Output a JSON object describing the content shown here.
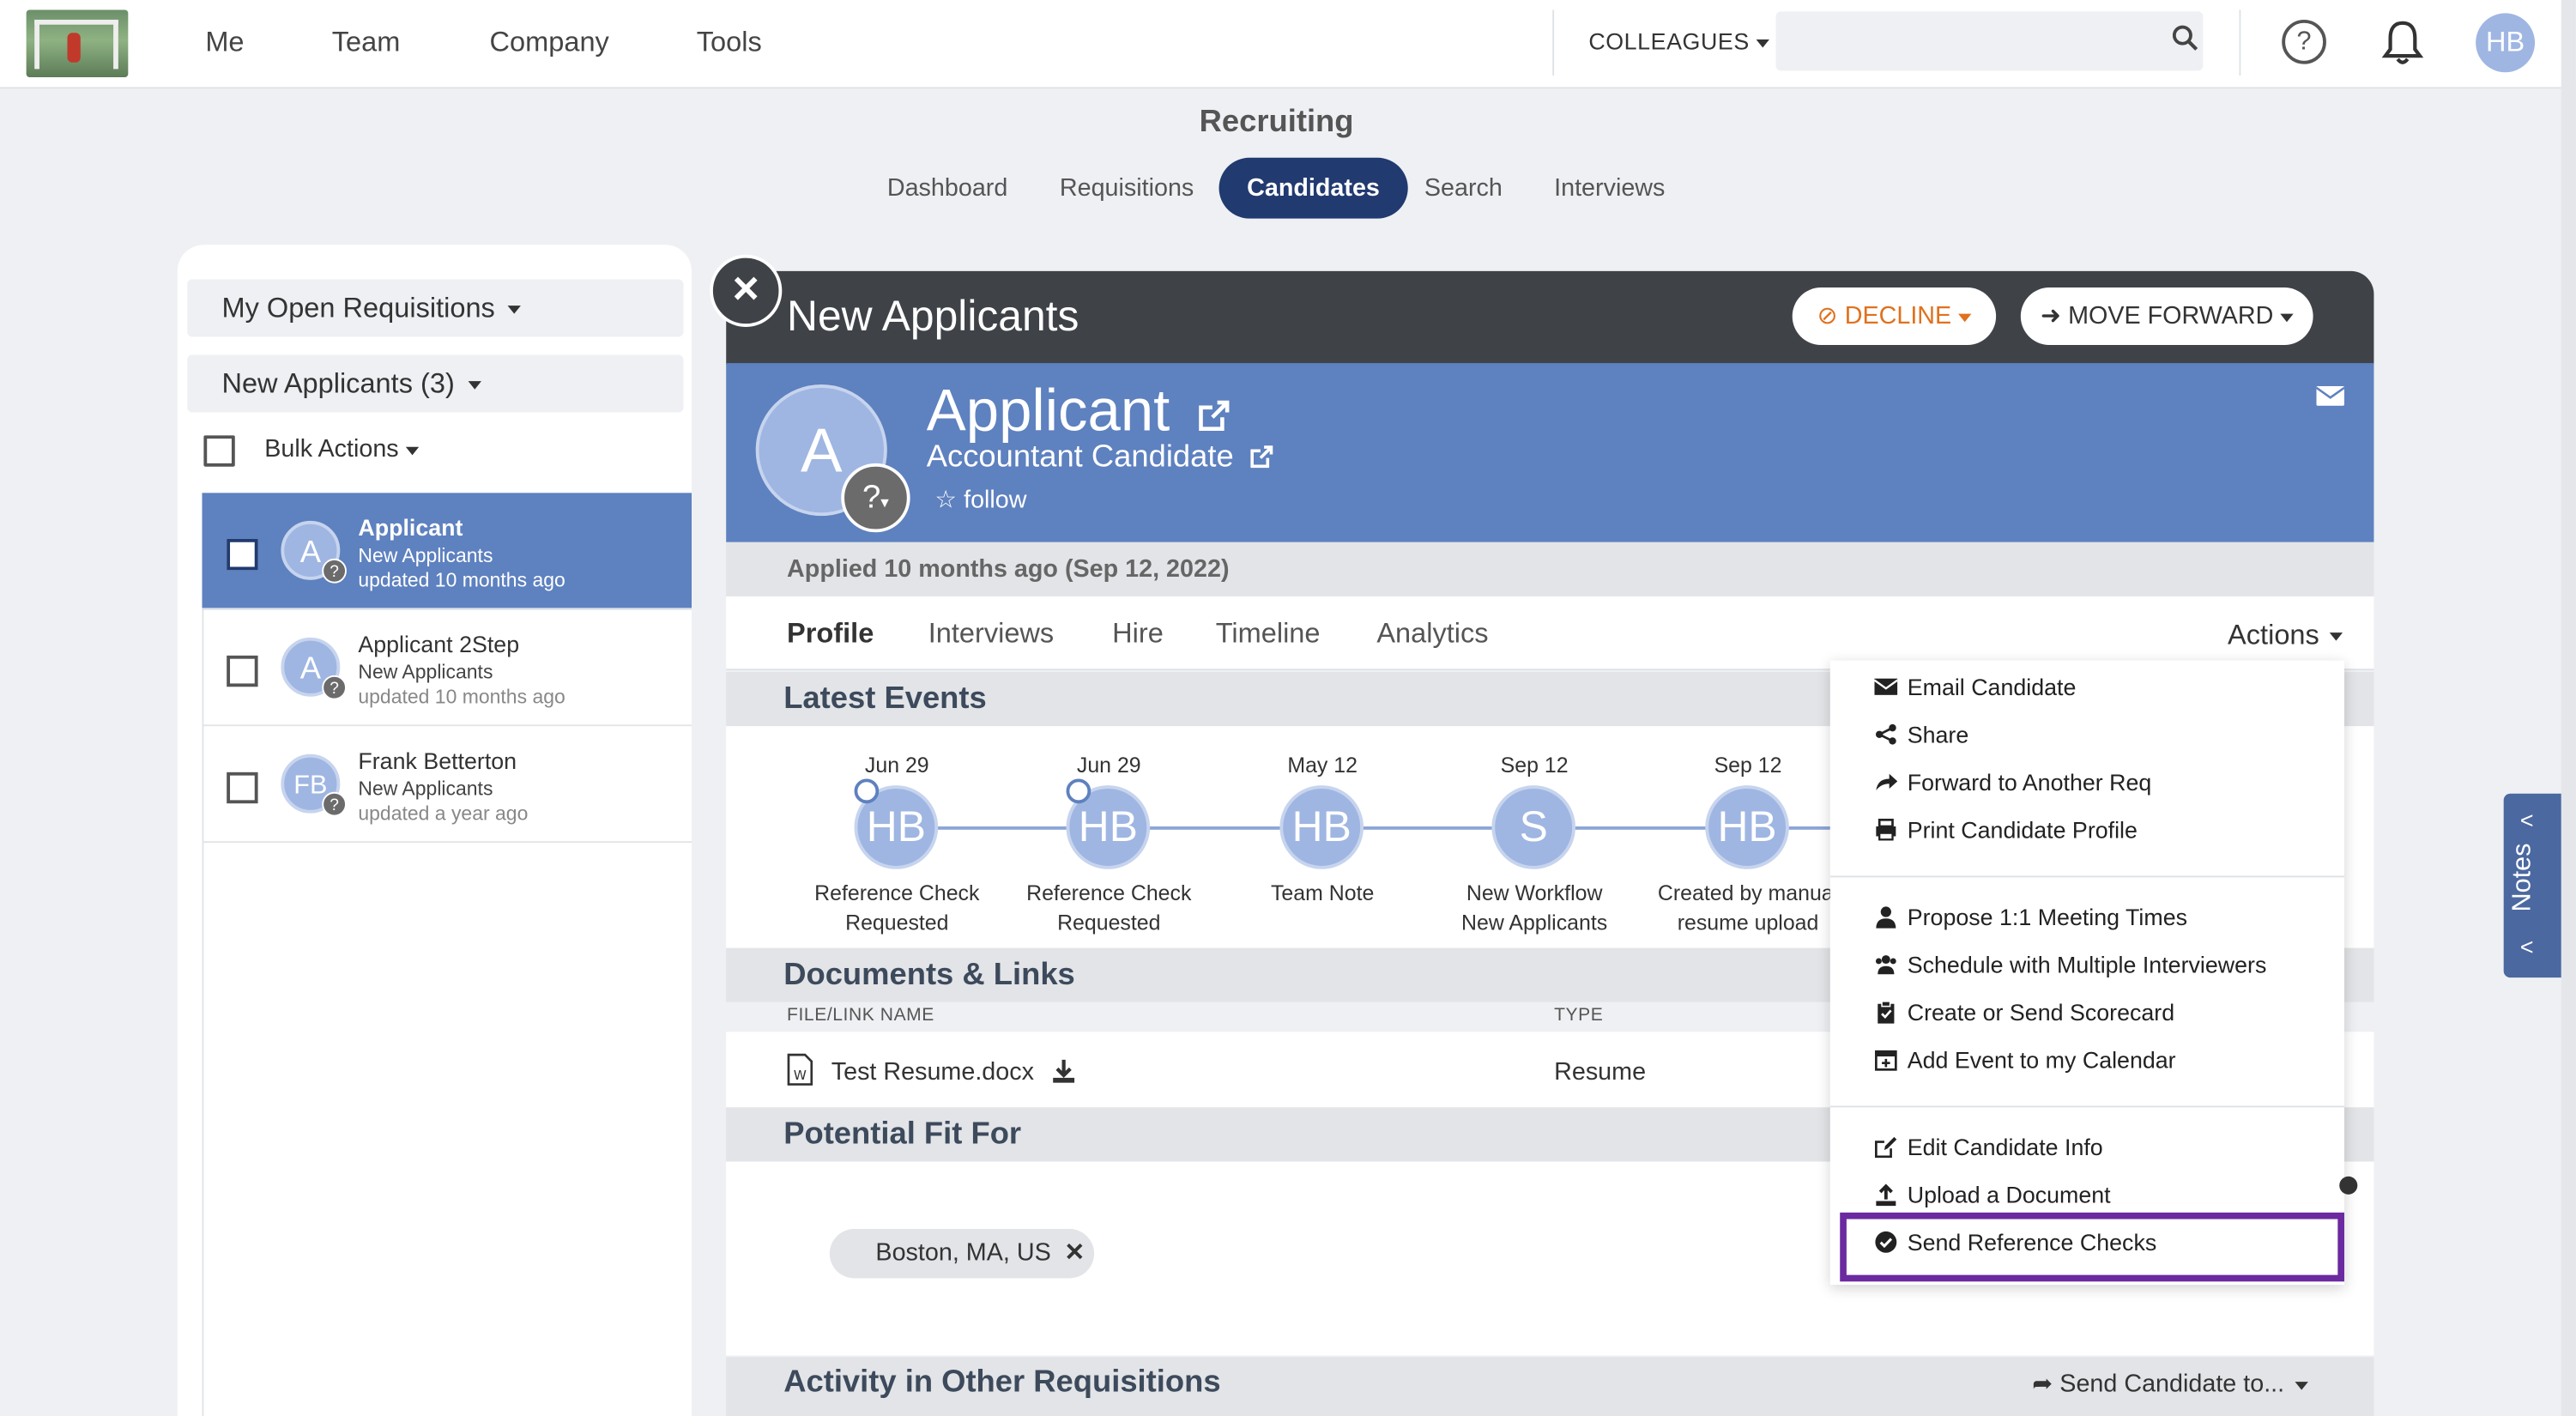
{
  "topnav": {
    "items": [
      "Me",
      "Team",
      "Company",
      "Tools"
    ],
    "colleagues_label": "COLLEAGUES",
    "search_value": "",
    "help_glyph": "?",
    "user_initials": "HB"
  },
  "recruiting": {
    "title": "Recruiting",
    "tabs": [
      "Dashboard",
      "Requisitions",
      "Candidates",
      "Search",
      "Interviews"
    ],
    "active_tab": "Candidates"
  },
  "left_panel": {
    "requisition_filter": "My Open Requisitions",
    "stage_filter": "New Applicants (3)",
    "bulk_actions": "Bulk Actions",
    "candidates": [
      {
        "initials": "A",
        "name": "Applicant",
        "stage": "New Applicants",
        "updated": "updated 10 months ago",
        "active": true
      },
      {
        "initials": "A",
        "name": "Applicant 2Step",
        "stage": "New Applicants",
        "updated": "updated 10 months ago",
        "active": false
      },
      {
        "initials": "FB",
        "name": "Frank Betterton",
        "stage": "New Applicants",
        "updated": "updated a year ago",
        "active": false
      }
    ]
  },
  "detail": {
    "stage_title": "New Applicants",
    "decline_label": "DECLINE",
    "move_forward_label": "MOVE FORWARD",
    "avatar_initial": "A",
    "candidate_name": "Applicant",
    "candidate_role": "Accountant Candidate",
    "follow_label": "follow",
    "applied": "Applied 10 months ago (Sep 12, 2022)",
    "tabs": [
      "Profile",
      "Interviews",
      "Hire",
      "Timeline",
      "Analytics"
    ],
    "actions_label": "Actions",
    "latest_events_title": "Latest Events",
    "events": [
      {
        "date": "Jun 29",
        "initials": "HB",
        "label1": "Reference Check",
        "label2": "Requested"
      },
      {
        "date": "Jun 29",
        "initials": "HB",
        "label1": "Reference Check",
        "label2": "Requested"
      },
      {
        "date": "May 12",
        "initials": "HB",
        "label1": "Team Note",
        "label2": ""
      },
      {
        "date": "Sep 12",
        "initials": "S",
        "label1": "New Workflow",
        "label2": "New Applicants"
      },
      {
        "date": "Sep 12",
        "initials": "HB",
        "label1": "Created by manual",
        "label2": "resume upload"
      }
    ],
    "documents_title": "Documents & Links",
    "doc_col_name": "FILE/LINK NAME",
    "doc_col_type": "TYPE",
    "doc_name": "Test Resume.docx",
    "doc_type": "Resume",
    "potential_fit_title": "Potential Fit For",
    "fit_location": "Boston, MA, US",
    "activity_title": "Activity in Other Requisitions",
    "send_candidate_to": "Send Candidate to..."
  },
  "actions_menu": {
    "group1": [
      "Email Candidate",
      "Share",
      "Forward to Another Req",
      "Print Candidate Profile"
    ],
    "group2": [
      "Propose 1:1 Meeting Times",
      "Schedule with Multiple Interviewers",
      "Create or Send Scorecard",
      "Add Event to my Calendar"
    ],
    "group3": [
      "Edit Candidate Info",
      "Upload a Document",
      "Send Reference Checks"
    ],
    "highlighted": "Send Reference Checks"
  },
  "notes_label": "Notes",
  "colors": {
    "navy": "#213a70",
    "blue": "#5e81bf",
    "dark_header": "#3f4348",
    "decline_orange": "#e0711d",
    "highlight_purple": "#6b2aa0"
  }
}
